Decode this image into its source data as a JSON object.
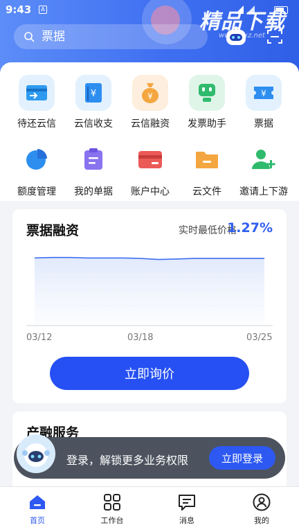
{
  "status_bar": {
    "time": "9:43",
    "sim_glyph": "A"
  },
  "watermark": {
    "text": "精品下载",
    "sub": "www.jpxz.net"
  },
  "search": {
    "placeholder": "票据"
  },
  "grid": {
    "row1": [
      {
        "label": "待还云信",
        "icon": "card-arrow-icon"
      },
      {
        "label": "云信收支",
        "icon": "ledger-icon"
      },
      {
        "label": "云信融资",
        "icon": "money-bag-icon"
      },
      {
        "label": "发票助手",
        "icon": "invoice-robot-icon"
      },
      {
        "label": "票据",
        "icon": "ticket-icon"
      }
    ],
    "row2": [
      {
        "label": "额度管理",
        "icon": "pie-icon"
      },
      {
        "label": "我的单据",
        "icon": "clipboard-icon"
      },
      {
        "label": "账户中心",
        "icon": "wallet-card-icon"
      },
      {
        "label": "云文件",
        "icon": "folder-icon"
      },
      {
        "label": "邀请上下游",
        "icon": "add-user-icon"
      }
    ]
  },
  "finance": {
    "title": "票据融资",
    "rate_label": "实时最低价格",
    "rate": "1.27%",
    "cta": "立即询价"
  },
  "chart_data": {
    "type": "area",
    "x": [
      "03/12",
      "03/13",
      "03/14",
      "03/15",
      "03/16",
      "03/17",
      "03/18",
      "03/19",
      "03/20",
      "03/21",
      "03/22",
      "03/23",
      "03/24",
      "03/25"
    ],
    "values": [
      1.3,
      1.31,
      1.31,
      1.3,
      1.3,
      1.3,
      1.29,
      1.27,
      1.28,
      1.29,
      1.29,
      1.29,
      1.29,
      1.29
    ],
    "tick_labels": [
      "03/12",
      "03/18",
      "03/25"
    ],
    "color": "#3f6ff1",
    "grid": false
  },
  "services": {
    "title": "产融服务"
  },
  "login_bar": {
    "text": "登录，解锁更多业务权限",
    "button": "立即登录"
  },
  "bottom_nav": [
    {
      "label": "首页",
      "icon": "home-icon",
      "active": true
    },
    {
      "label": "工作台",
      "icon": "grid-icon",
      "active": false
    },
    {
      "label": "消息",
      "icon": "message-icon",
      "active": false
    },
    {
      "label": "我的",
      "icon": "profile-icon",
      "active": false
    }
  ],
  "colors": {
    "primary": "#2650f3",
    "header_start": "#5c8df8",
    "header_end": "#2f5fe6"
  }
}
